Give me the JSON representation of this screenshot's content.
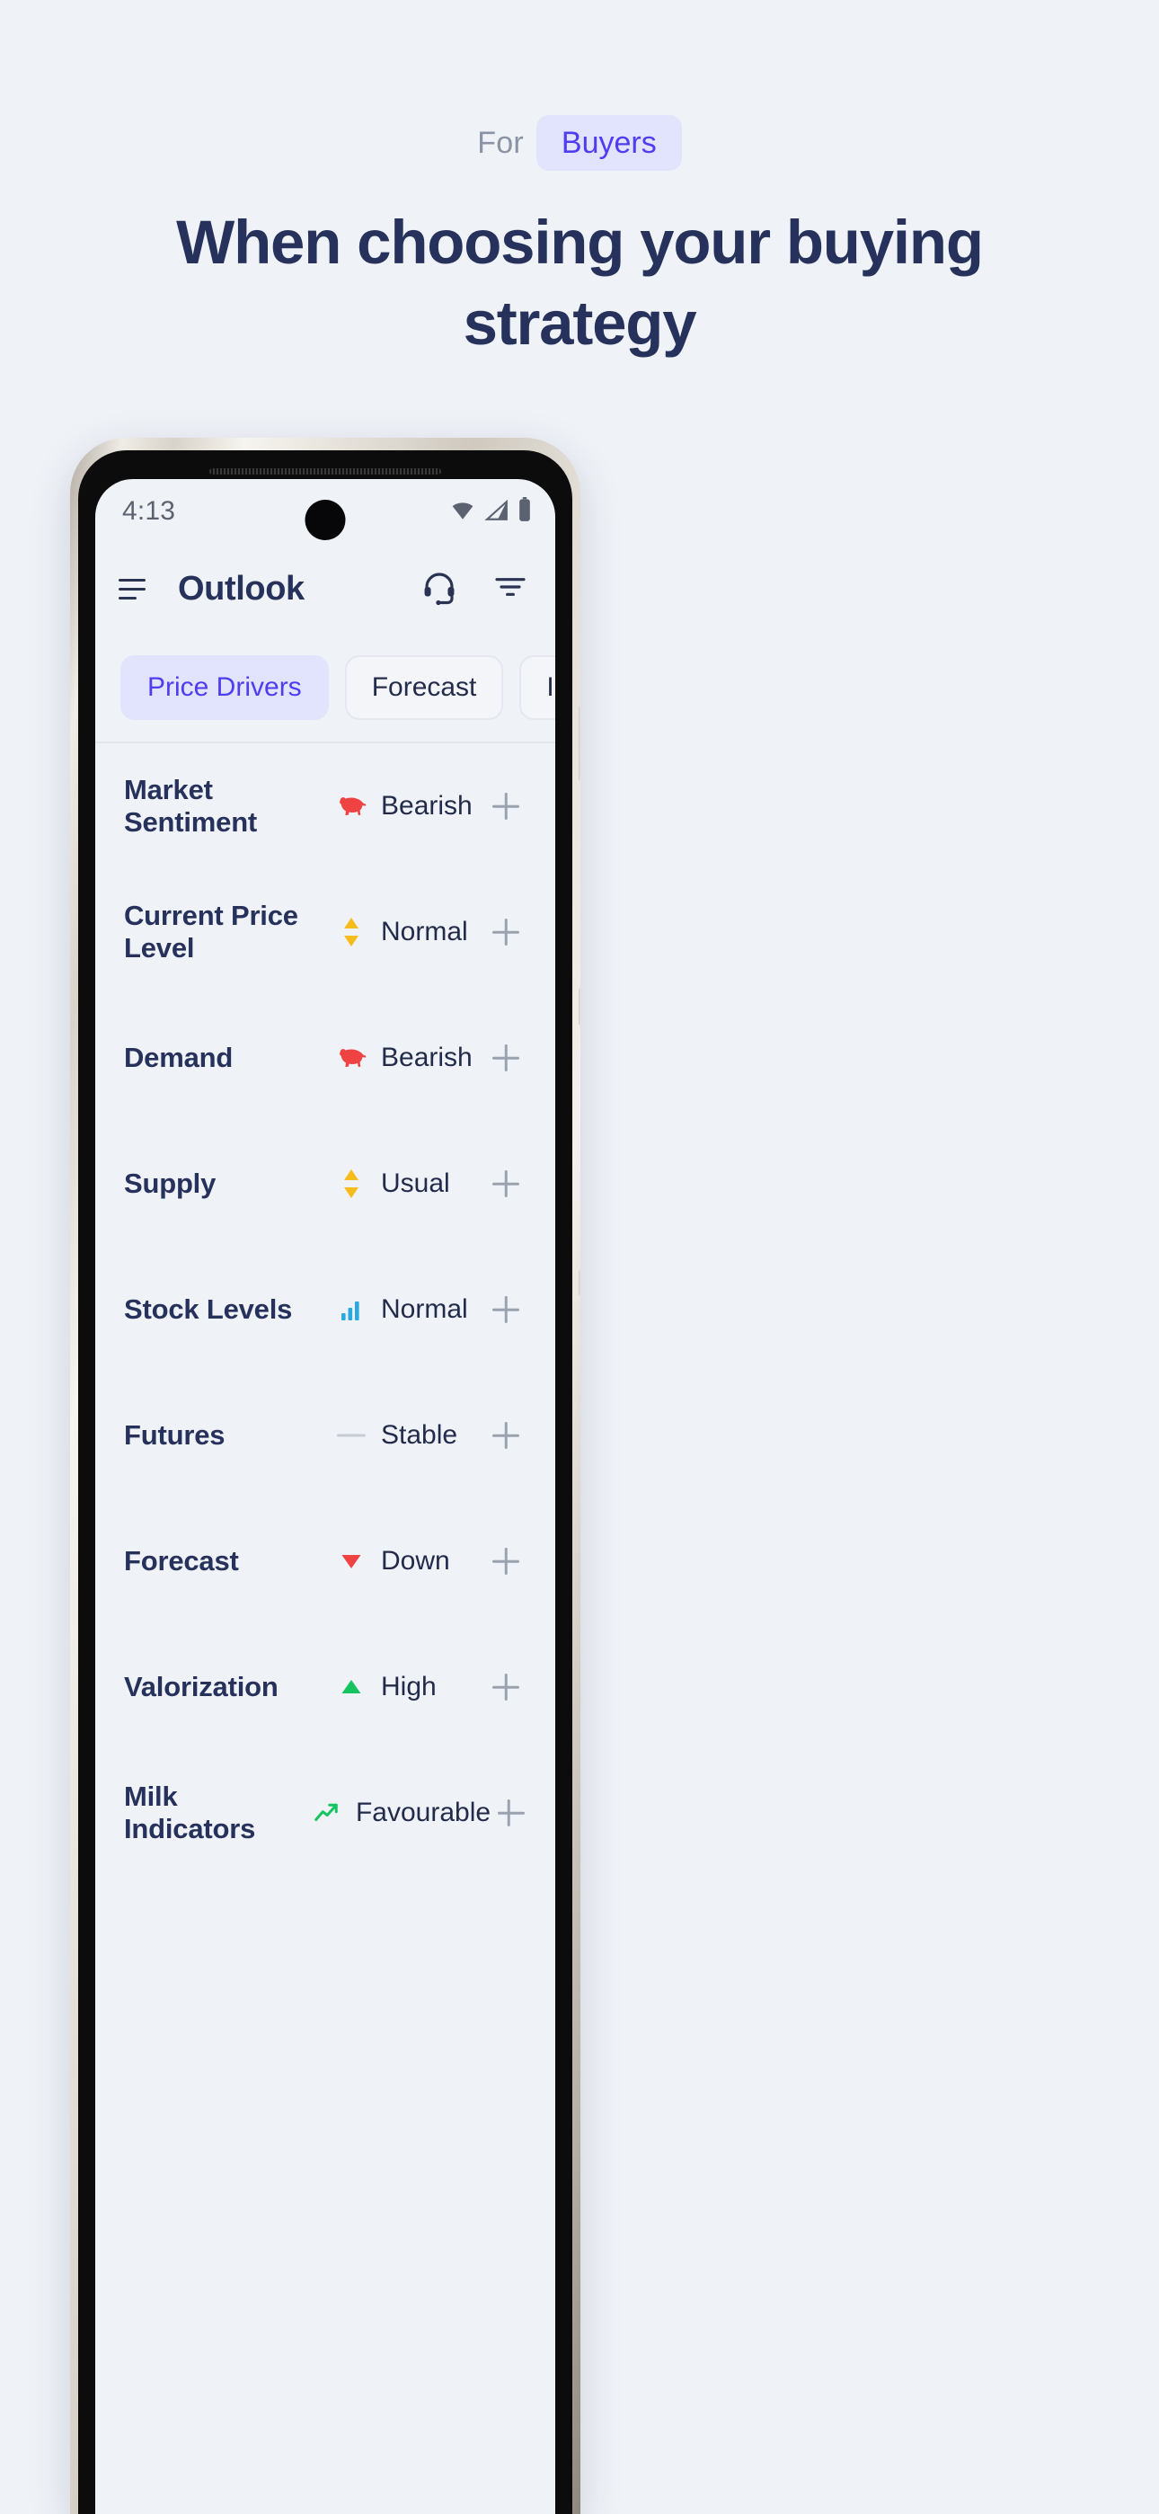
{
  "promo": {
    "eyebrow_prefix": "For",
    "eyebrow_pill": "Buyers",
    "headline": "When choosing your buying strategy",
    "accent_color": "#4f3df2",
    "pill_bg": "#e2e3fc",
    "headline_color": "#26325c",
    "page_bg": "#eff2f7"
  },
  "phone": {
    "statusbar": {
      "time": "4:13",
      "icons": [
        "wifi-icon",
        "cellular-signal-icon",
        "battery-icon"
      ]
    },
    "appbar": {
      "menu_icon": "hamburger-menu-icon",
      "title": "Outlook",
      "actions": [
        "headset-support-icon",
        "filter-icon"
      ]
    },
    "tabs": [
      {
        "label": "Price Drivers",
        "active": true
      },
      {
        "label": "Forecast",
        "active": false
      },
      {
        "label": "Insights",
        "active": false
      }
    ],
    "drivers": [
      {
        "label": "Market Sentiment",
        "value": "Bearish",
        "icon": "bear-icon",
        "icon_color": "#ef4343"
      },
      {
        "label": "Current Price Level",
        "value": "Normal",
        "icon": "up-down-arrows-icon",
        "icon_color": "#f5bc1a"
      },
      {
        "label": "Demand",
        "value": "Bearish",
        "icon": "bear-icon",
        "icon_color": "#ef4343"
      },
      {
        "label": "Supply",
        "value": "Usual",
        "icon": "up-down-arrows-icon",
        "icon_color": "#f5bc1a"
      },
      {
        "label": "Stock Levels",
        "value": "Normal",
        "icon": "bar-chart-icon",
        "icon_color": "#2aa8e0"
      },
      {
        "label": "Futures",
        "value": "Stable",
        "icon": "dash-icon",
        "icon_color": "#c6cbd4"
      },
      {
        "label": "Forecast",
        "value": "Down",
        "icon": "triangle-down-icon",
        "icon_color": "#ef4343"
      },
      {
        "label": "Valorization",
        "value": "High",
        "icon": "triangle-up-icon",
        "icon_color": "#16c45f"
      },
      {
        "label": "Milk Indicators",
        "value": "Favourable",
        "icon": "trending-up-icon",
        "icon_color": "#16c45f"
      }
    ],
    "expand_icon": "plus-icon"
  }
}
